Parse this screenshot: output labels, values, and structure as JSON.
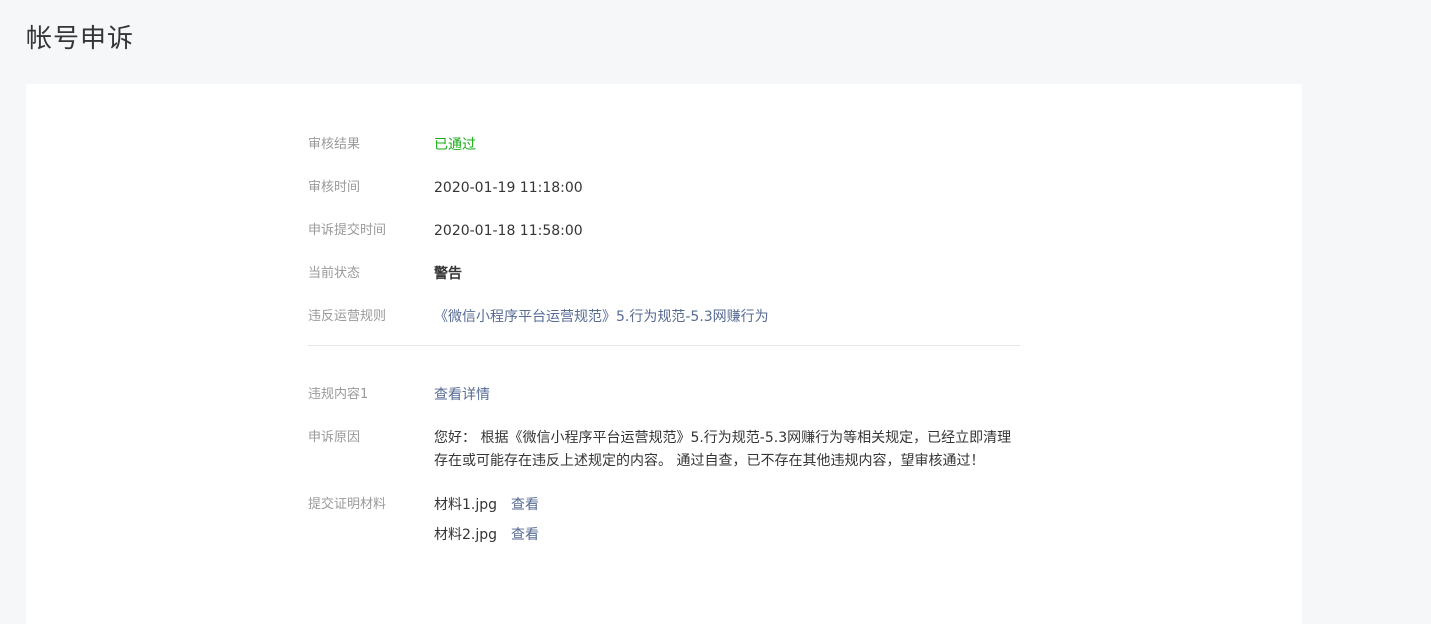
{
  "page": {
    "title": "帐号申诉"
  },
  "review": {
    "result_label": "审核结果",
    "result_value": "已通过",
    "time_label": "审核时间",
    "time_value": "2020-01-19 11:18:00",
    "submit_label": "申诉提交时间",
    "submit_value": "2020-01-18 11:58:00",
    "status_label": "当前状态",
    "status_value": "警告",
    "rule_label": "违反运营规则",
    "rule_value": "《微信小程序平台运营规范》5.行为规范-5.3网赚行为"
  },
  "detail": {
    "content_label": "违规内容1",
    "content_link": "查看详情",
    "reason_label": "申诉原因",
    "reason_text": "您好： 根据《微信小程序平台运营规范》5.行为规范-5.3网赚行为等相关规定，已经立即清理存在或可能存在违反上述规定的内容。 通过自查，已不存在其他违规内容，望审核通过！",
    "materials_label": "提交证明材料",
    "materials": [
      {
        "name": "材料1.jpg",
        "view": "查看"
      },
      {
        "name": "材料2.jpg",
        "view": "查看"
      }
    ]
  },
  "colors": {
    "success": "#1aad19",
    "link": "#576b95",
    "label": "#9a9a9a"
  }
}
